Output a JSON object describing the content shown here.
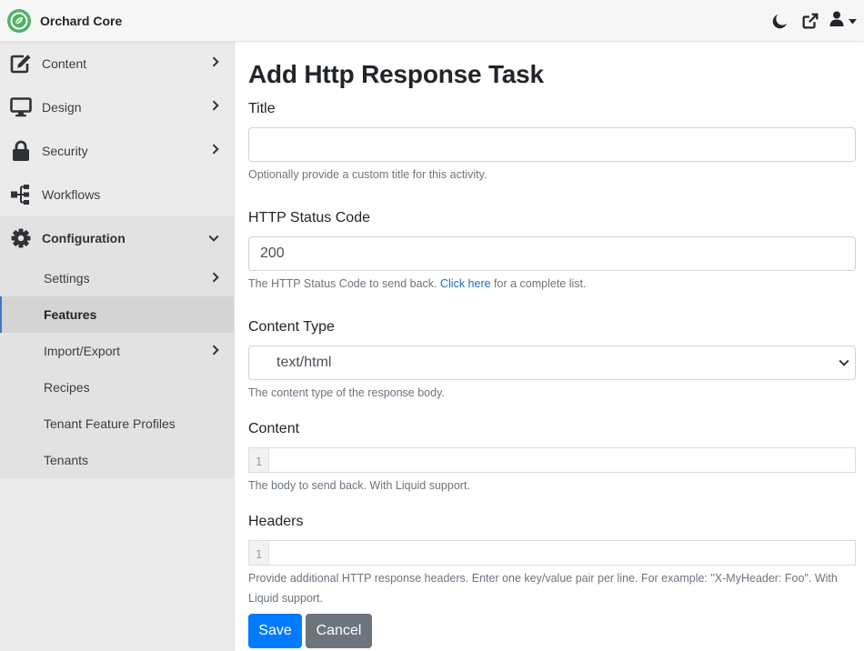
{
  "brand": {
    "name": "Orchard Core"
  },
  "colors": {
    "accent": "#007bff",
    "brand_green": "#4fb265",
    "secondary": "#6c757d",
    "link": "#1b6ec2"
  },
  "topbar": {
    "icons": [
      "moon-icon",
      "external-link-icon",
      "user-icon"
    ]
  },
  "sidebar": {
    "items": [
      {
        "label": "Content",
        "icon": "edit-icon",
        "chevron": "right"
      },
      {
        "label": "Design",
        "icon": "monitor-icon",
        "chevron": "right"
      },
      {
        "label": "Security",
        "icon": "lock-icon",
        "chevron": "right"
      },
      {
        "label": "Workflows",
        "icon": "sitemap-icon"
      },
      {
        "label": "Configuration",
        "icon": "cog-icon",
        "chevron": "down"
      }
    ],
    "subitems": [
      {
        "label": "Settings",
        "chevron": "right"
      },
      {
        "label": "Features",
        "active": true
      },
      {
        "label": "Import/Export",
        "chevron": "right"
      },
      {
        "label": "Recipes"
      },
      {
        "label": "Tenant Feature Profiles"
      },
      {
        "label": "Tenants"
      }
    ]
  },
  "form": {
    "title": "Add Http Response Task",
    "title_field": {
      "label": "Title",
      "value": "",
      "help": "Optionally provide a custom title for this activity."
    },
    "status_field": {
      "label": "HTTP Status Code",
      "value": "200",
      "help_before": "The HTTP Status Code to send back. ",
      "help_link": "Click here",
      "help_after": " for a complete list."
    },
    "content_type_field": {
      "label": "Content Type",
      "value": "text/html",
      "help": "The content type of the response body."
    },
    "content_field": {
      "label": "Content",
      "line_number": "1",
      "help": "The body to send back. With Liquid support."
    },
    "headers_field": {
      "label": "Headers",
      "line_number": "1",
      "help": "Provide additional HTTP response headers. Enter one key/value pair per line. For example: \"X-MyHeader: Foo\". With Liquid support."
    },
    "save_label": "Save",
    "cancel_label": "Cancel"
  }
}
